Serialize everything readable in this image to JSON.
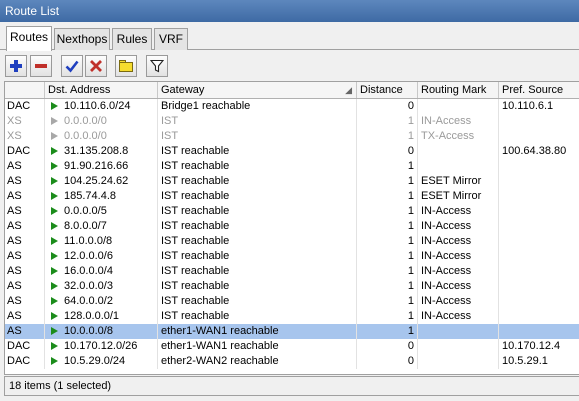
{
  "window": {
    "title": "Route List"
  },
  "tabs": [
    {
      "label": "Routes",
      "active": true
    },
    {
      "label": "Nexthops",
      "active": false
    },
    {
      "label": "Rules",
      "active": false
    },
    {
      "label": "VRF",
      "active": false
    }
  ],
  "toolbar": {
    "buttons": [
      {
        "name": "add",
        "icon": "plus-icon",
        "color": "#1f3fbf"
      },
      {
        "name": "remove",
        "icon": "minus-icon",
        "color": "#c0302a"
      },
      {
        "name": "enable",
        "icon": "check-icon",
        "color": "#1f3fbf"
      },
      {
        "name": "disable",
        "icon": "x-icon",
        "color": "#c0302a"
      },
      {
        "name": "comment",
        "icon": "note-icon",
        "color": "#f5dc2e"
      },
      {
        "name": "filter",
        "icon": "funnel-icon",
        "color": "#222222"
      }
    ]
  },
  "table": {
    "columns": [
      "",
      "Dst. Address",
      "Gateway",
      "Distance",
      "Routing Mark",
      "Pref. Source"
    ],
    "sort_column": "Gateway",
    "rows": [
      {
        "flags": "DAC",
        "dst": "10.110.6.0/24",
        "gateway": "Bridge1 reachable",
        "distance": "0",
        "routing_mark": "",
        "pref_source": "10.110.6.1",
        "inactive": false,
        "selected": false
      },
      {
        "flags": "XS",
        "dst": "0.0.0.0/0",
        "gateway": "IST",
        "distance": "1",
        "routing_mark": "IN-Access",
        "pref_source": "",
        "inactive": true,
        "selected": false
      },
      {
        "flags": "XS",
        "dst": "0.0.0.0/0",
        "gateway": "IST",
        "distance": "1",
        "routing_mark": "TX-Access",
        "pref_source": "",
        "inactive": true,
        "selected": false
      },
      {
        "flags": "DAC",
        "dst": "31.135.208.8",
        "gateway": "IST reachable",
        "distance": "0",
        "routing_mark": "",
        "pref_source": "100.64.38.80",
        "inactive": false,
        "selected": false
      },
      {
        "flags": "AS",
        "dst": "91.90.216.66",
        "gateway": "IST reachable",
        "distance": "1",
        "routing_mark": "",
        "pref_source": "",
        "inactive": false,
        "selected": false
      },
      {
        "flags": "AS",
        "dst": "104.25.24.62",
        "gateway": "IST reachable",
        "distance": "1",
        "routing_mark": "ESET Mirror",
        "pref_source": "",
        "inactive": false,
        "selected": false
      },
      {
        "flags": "AS",
        "dst": "185.74.4.8",
        "gateway": "IST reachable",
        "distance": "1",
        "routing_mark": "ESET Mirror",
        "pref_source": "",
        "inactive": false,
        "selected": false
      },
      {
        "flags": "AS",
        "dst": "0.0.0.0/5",
        "gateway": "IST reachable",
        "distance": "1",
        "routing_mark": "IN-Access",
        "pref_source": "",
        "inactive": false,
        "selected": false
      },
      {
        "flags": "AS",
        "dst": "8.0.0.0/7",
        "gateway": "IST reachable",
        "distance": "1",
        "routing_mark": "IN-Access",
        "pref_source": "",
        "inactive": false,
        "selected": false
      },
      {
        "flags": "AS",
        "dst": "11.0.0.0/8",
        "gateway": "IST reachable",
        "distance": "1",
        "routing_mark": "IN-Access",
        "pref_source": "",
        "inactive": false,
        "selected": false
      },
      {
        "flags": "AS",
        "dst": "12.0.0.0/6",
        "gateway": "IST reachable",
        "distance": "1",
        "routing_mark": "IN-Access",
        "pref_source": "",
        "inactive": false,
        "selected": false
      },
      {
        "flags": "AS",
        "dst": "16.0.0.0/4",
        "gateway": "IST reachable",
        "distance": "1",
        "routing_mark": "IN-Access",
        "pref_source": "",
        "inactive": false,
        "selected": false
      },
      {
        "flags": "AS",
        "dst": "32.0.0.0/3",
        "gateway": "IST reachable",
        "distance": "1",
        "routing_mark": "IN-Access",
        "pref_source": "",
        "inactive": false,
        "selected": false
      },
      {
        "flags": "AS",
        "dst": "64.0.0.0/2",
        "gateway": "IST reachable",
        "distance": "1",
        "routing_mark": "IN-Access",
        "pref_source": "",
        "inactive": false,
        "selected": false
      },
      {
        "flags": "AS",
        "dst": "128.0.0.0/1",
        "gateway": "IST reachable",
        "distance": "1",
        "routing_mark": "IN-Access",
        "pref_source": "",
        "inactive": false,
        "selected": false
      },
      {
        "flags": "AS",
        "dst": "10.0.0.0/8",
        "gateway": "ether1-WAN1 reachable",
        "distance": "1",
        "routing_mark": "",
        "pref_source": "",
        "inactive": false,
        "selected": true
      },
      {
        "flags": "DAC",
        "dst": "10.170.12.0/26",
        "gateway": "ether1-WAN1 reachable",
        "distance": "0",
        "routing_mark": "",
        "pref_source": "10.170.12.4",
        "inactive": false,
        "selected": false
      },
      {
        "flags": "DAC",
        "dst": "10.5.29.0/24",
        "gateway": "ether2-WAN2 reachable",
        "distance": "0",
        "routing_mark": "",
        "pref_source": "10.5.29.1",
        "inactive": false,
        "selected": false
      }
    ]
  },
  "status": {
    "text": "18 items (1 selected)"
  },
  "colors": {
    "selection": "#a7c5ed",
    "route_active": "#1b8c1b",
    "route_inactive": "#a8a8a8",
    "titlebar": "#4a76ae"
  }
}
